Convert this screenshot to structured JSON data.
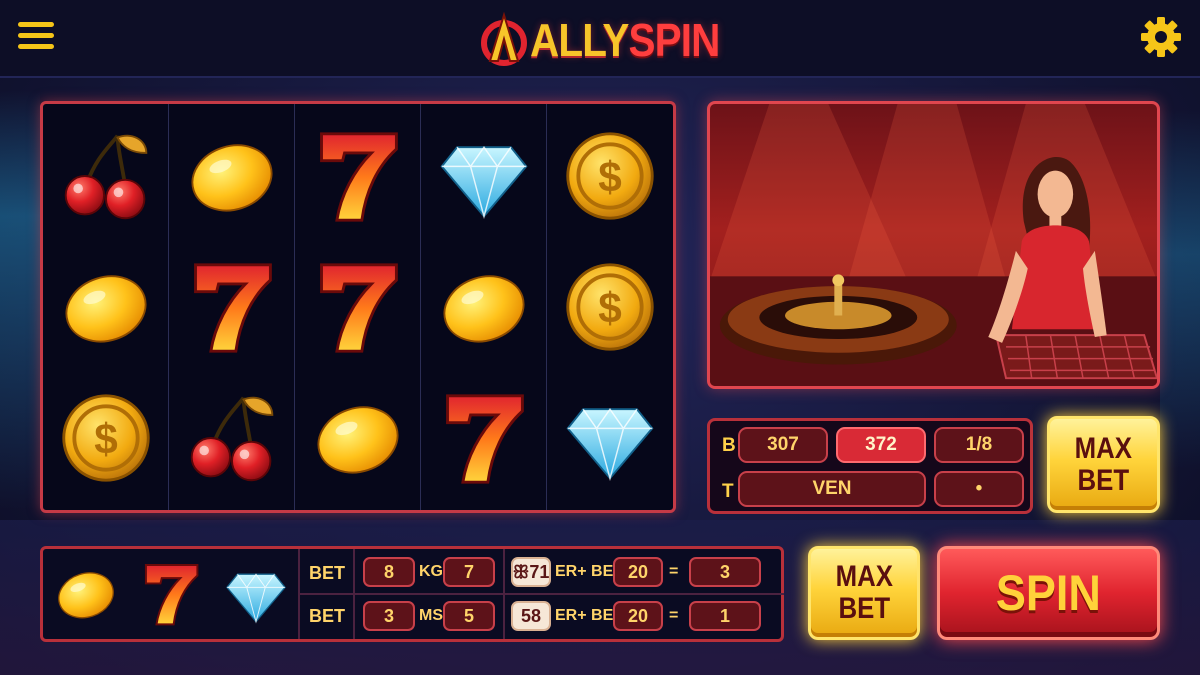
{
  "app": {
    "logo_text_a": "ALLY",
    "logo_text_b": "SPIN",
    "colors": {
      "accent_gold": "#f5c518",
      "accent_red": "#e0242f",
      "panel_border": "#c53a46"
    }
  },
  "header": {
    "menu_icon": "hamburger-menu-icon",
    "settings_icon": "gear-icon"
  },
  "reels": [
    [
      "cherry",
      "lemon",
      "coin"
    ],
    [
      "lemon",
      "seven",
      "cherry"
    ],
    [
      "seven",
      "seven",
      "lemon"
    ],
    [
      "diamond",
      "lemon",
      "seven"
    ],
    [
      "coin",
      "coin",
      "diamond"
    ]
  ],
  "bet_info": {
    "row1_label": "B",
    "row2_label": "T",
    "row1_values": [
      "307",
      "372",
      "1/8"
    ],
    "row2_values": [
      "VEN",
      "•"
    ]
  },
  "max_bet_top": {
    "line1": "MAX",
    "line2": "BET"
  },
  "max_bet_bottom": {
    "line1": "MAX",
    "line2": "BET"
  },
  "paytable": {
    "icons": [
      "lemon",
      "seven",
      "diamond"
    ],
    "rows": [
      {
        "label": "BET",
        "a": "8",
        "mid": "KG",
        "b": "7",
        "c": "ꕥ71",
        "expr": "ER+ BET",
        "d": "20",
        "eq": "=",
        "result": "3"
      },
      {
        "label": "BET",
        "a": "3",
        "mid": "MS",
        "b": "5",
        "c": "58",
        "expr": "ER+ BET",
        "d": "20",
        "eq": "=",
        "result": "1"
      }
    ]
  },
  "spin_button": {
    "label": "SPIN"
  }
}
